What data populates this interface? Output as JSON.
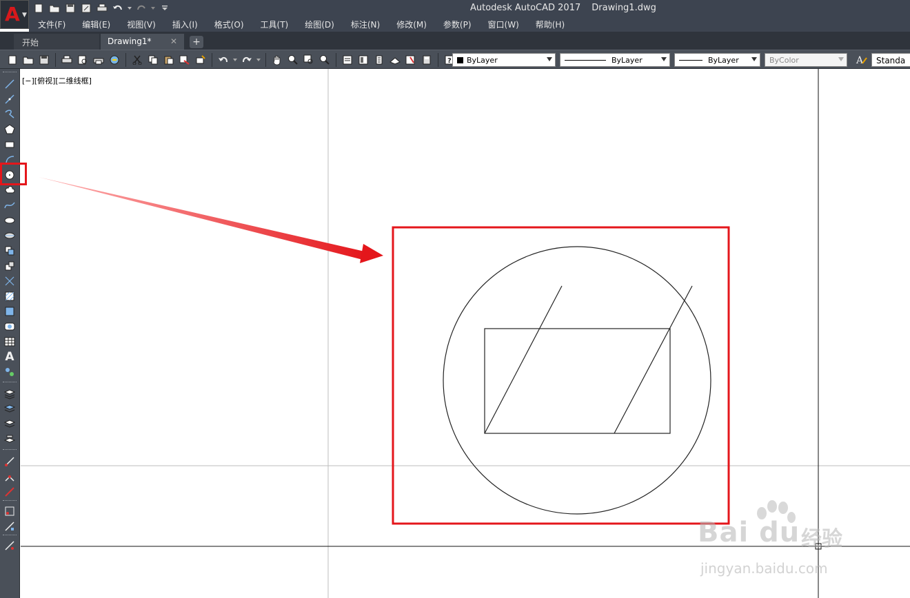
{
  "app": {
    "title": "Autodesk AutoCAD 2017",
    "filename": "Drawing1.dwg",
    "logo_letter": "A"
  },
  "menu": [
    "文件(F)",
    "编辑(E)",
    "视图(V)",
    "插入(I)",
    "格式(O)",
    "工具(T)",
    "绘图(D)",
    "标注(N)",
    "修改(M)",
    "参数(P)",
    "窗口(W)",
    "帮助(H)"
  ],
  "tabs": {
    "start": "开始",
    "drawing": "Drawing1*",
    "close": "✕",
    "add": "+"
  },
  "properties": {
    "color": "ByLayer",
    "linetype": "ByLayer",
    "lineweight": "ByLayer",
    "plotstyle": "ByColor",
    "textstyle": "Standa"
  },
  "viewport": {
    "label": "[−][俯视][二维线框]"
  },
  "watermark": {
    "brand": "Bai du",
    "cn": "经验",
    "url": "jingyan.baidu.com"
  },
  "colors": {
    "annotation": "#e4161b",
    "chrome": "#3d4450"
  }
}
